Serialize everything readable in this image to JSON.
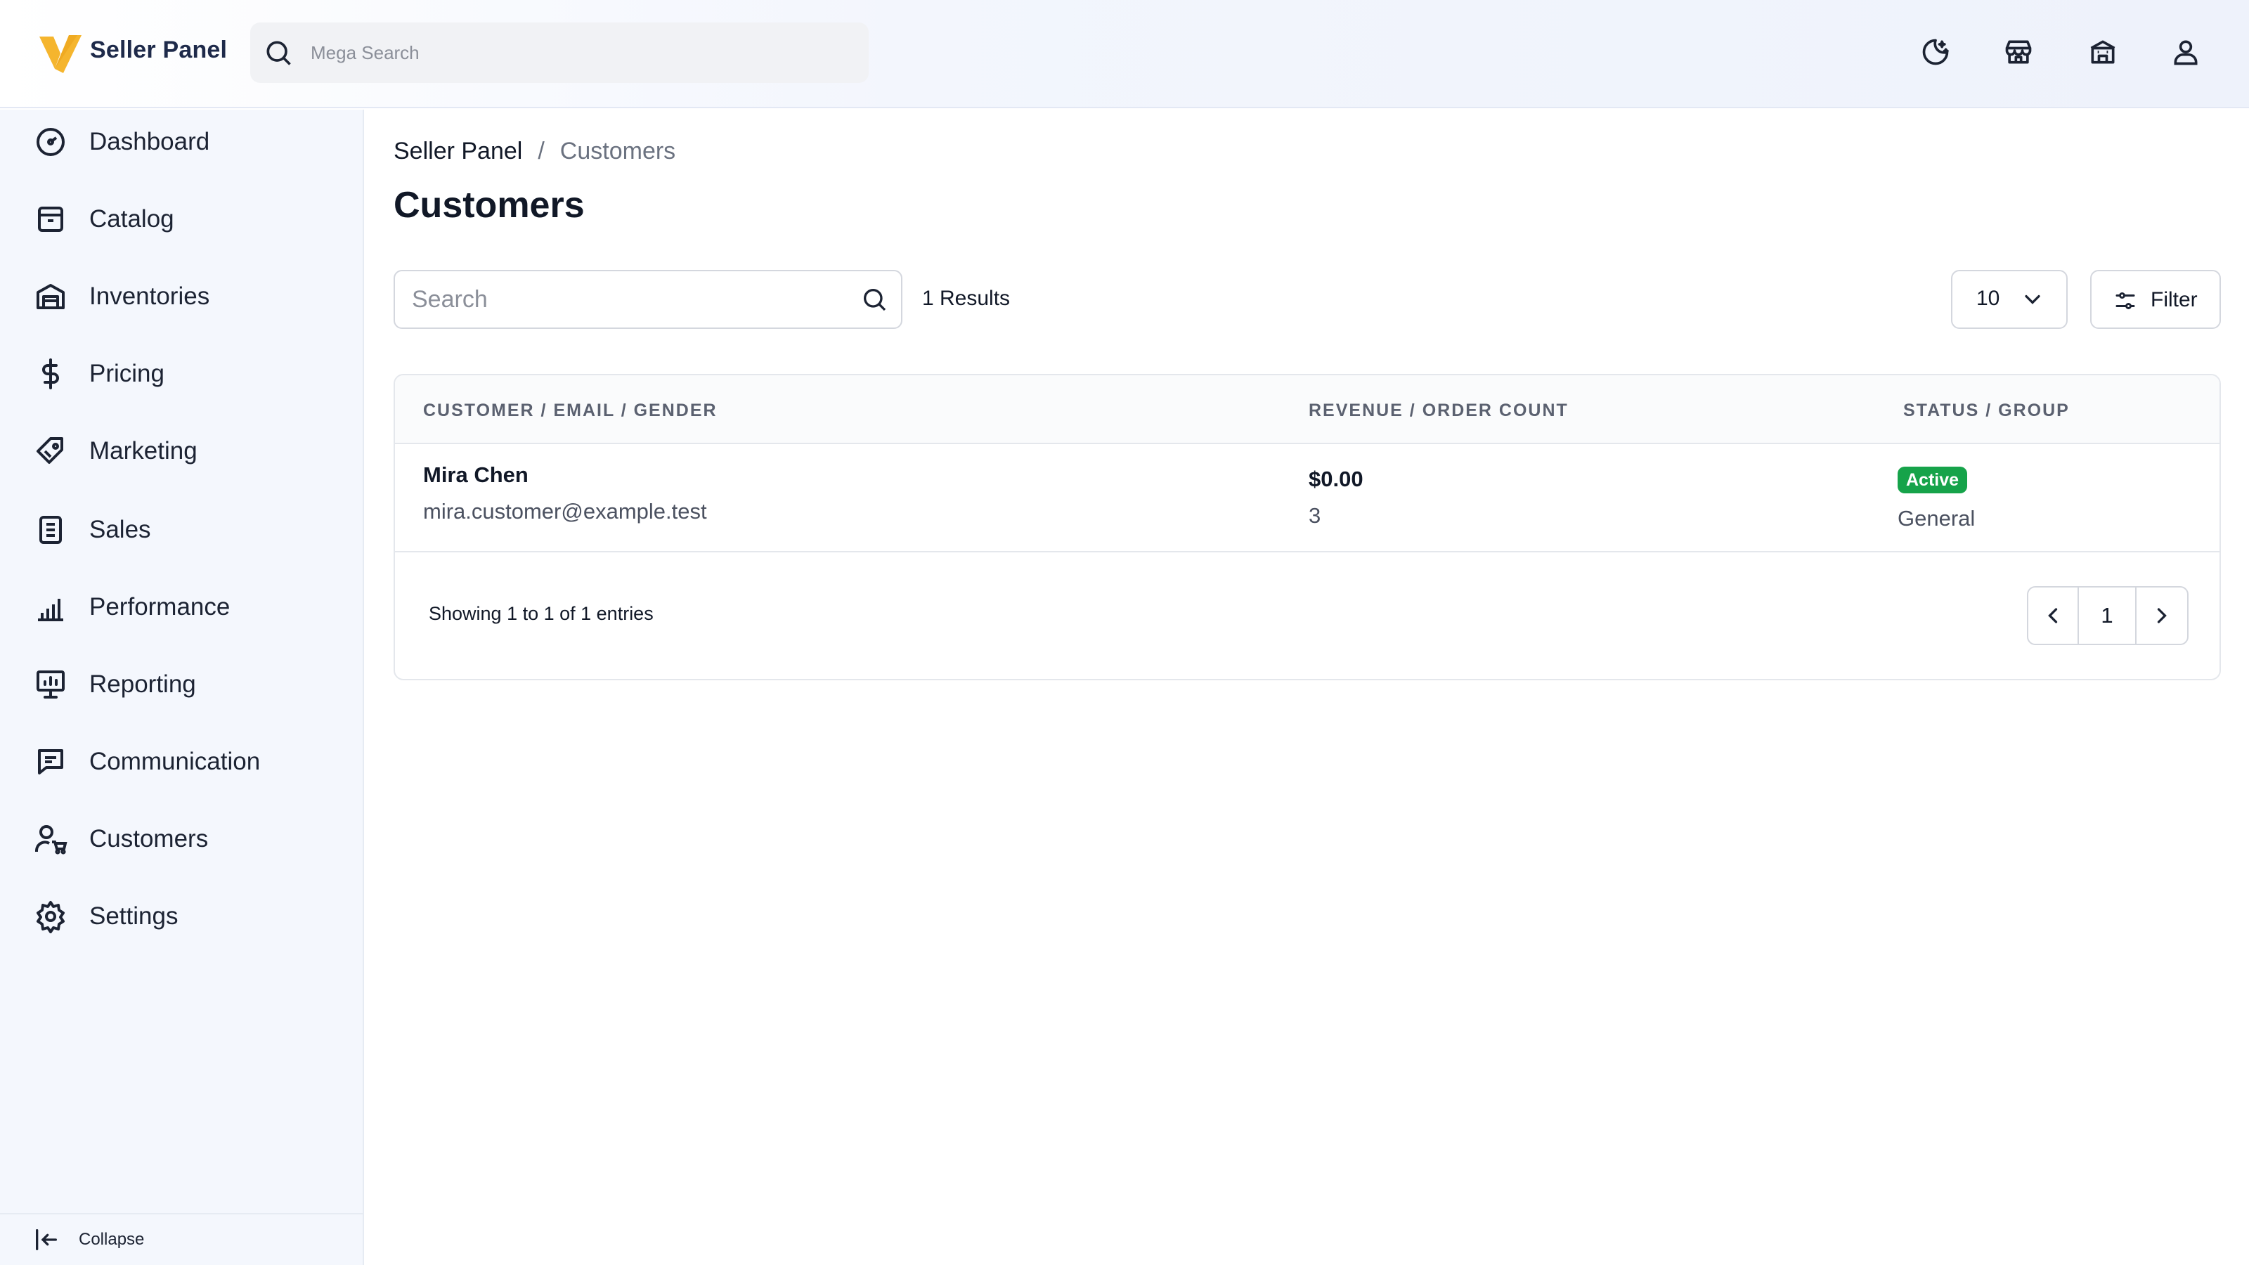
{
  "header": {
    "brand": "Seller Panel",
    "search_placeholder": "Mega Search",
    "actions": [
      "theme-toggle",
      "storefront",
      "store",
      "account"
    ]
  },
  "sidebar": {
    "items": [
      {
        "label": "Dashboard",
        "icon": "dashboard-gauge-icon"
      },
      {
        "label": "Catalog",
        "icon": "catalog-box-icon"
      },
      {
        "label": "Inventories",
        "icon": "warehouse-icon"
      },
      {
        "label": "Pricing",
        "icon": "dollar-icon"
      },
      {
        "label": "Marketing",
        "icon": "tag-icon"
      },
      {
        "label": "Sales",
        "icon": "document-icon"
      },
      {
        "label": "Performance",
        "icon": "bar-chart-icon"
      },
      {
        "label": "Reporting",
        "icon": "presentation-icon"
      },
      {
        "label": "Communication",
        "icon": "chat-icon"
      },
      {
        "label": "Customers",
        "icon": "user-cart-icon"
      },
      {
        "label": "Settings",
        "icon": "gear-icon"
      }
    ],
    "collapse_label": "Collapse"
  },
  "breadcrumb": {
    "root": "Seller Panel",
    "separator": "/",
    "current": "Customers"
  },
  "page_title": "Customers",
  "toolbar": {
    "search_placeholder": "Search",
    "results": "1 Results",
    "per_page": "10",
    "filter_label": "Filter"
  },
  "table": {
    "headers": [
      "CUSTOMER / EMAIL / GENDER",
      "REVENUE / ORDER COUNT",
      "STATUS / GROUP"
    ],
    "rows": [
      {
        "name": "Mira Chen",
        "email": "mira.customer@example.test",
        "revenue": "$0.00",
        "order_count": "3",
        "status": "Active",
        "group": "General"
      }
    ],
    "showing": "Showing 1 to 1 of 1 entries",
    "current_page": "1"
  },
  "colors": {
    "accent_green": "#16a34a",
    "logo_yellow": "#f5b52e",
    "logo_blue": "#3b5bdb"
  }
}
